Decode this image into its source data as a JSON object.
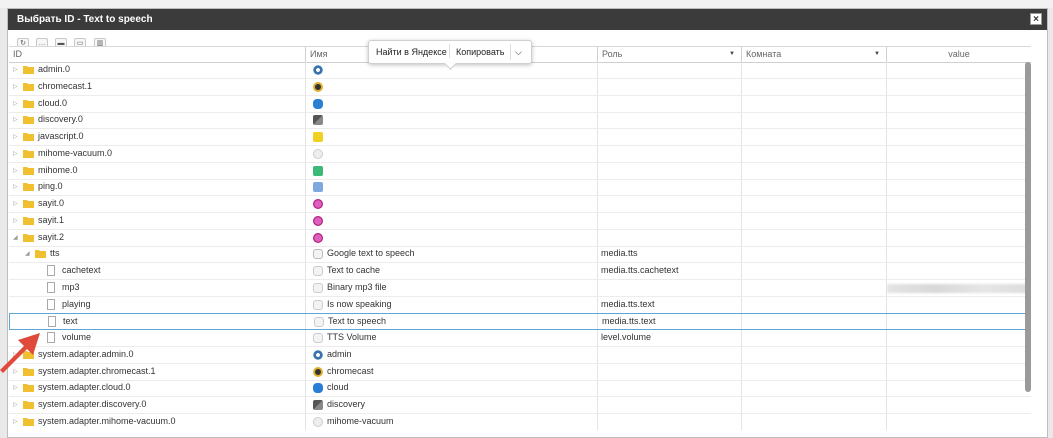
{
  "dialog": {
    "title": "Выбрать ID - Text to speech",
    "close_label": "×"
  },
  "toolbar": {
    "buttons": [
      "refresh",
      "more",
      "collapse",
      "expand",
      "columns"
    ]
  },
  "popup": {
    "search": "Найти в Яндексе",
    "copy": "Копировать",
    "more": "⌵"
  },
  "columns": {
    "id": "ID",
    "name": "Имя",
    "role": "Роль",
    "room": "Комната",
    "value": "value"
  },
  "colors": {
    "titlebar": "#3b3b3b",
    "selection_border": "#5ea5d8",
    "folder": "#f0c030",
    "arrow": "#e04a3a"
  },
  "rows": [
    {
      "id": "admin.0",
      "name": "",
      "role": "",
      "icon": "admin-icon",
      "type": "folder",
      "level": 0,
      "expanded": false
    },
    {
      "id": "chromecast.1",
      "name": "",
      "role": "",
      "icon": "chromecast-icon",
      "type": "folder",
      "level": 0,
      "expanded": false
    },
    {
      "id": "cloud.0",
      "name": "",
      "role": "",
      "icon": "cloud-icon",
      "type": "folder",
      "level": 0,
      "expanded": false
    },
    {
      "id": "discovery.0",
      "name": "",
      "role": "",
      "icon": "discovery-icon",
      "type": "folder",
      "level": 0,
      "expanded": false
    },
    {
      "id": "javascript.0",
      "name": "",
      "role": "",
      "icon": "javascript-icon",
      "type": "folder",
      "level": 0,
      "expanded": false
    },
    {
      "id": "mihome-vacuum.0",
      "name": "",
      "role": "",
      "icon": "mihome-vacuum-icon",
      "type": "folder",
      "level": 0,
      "expanded": false
    },
    {
      "id": "mihome.0",
      "name": "",
      "role": "",
      "icon": "mihome-icon",
      "type": "folder",
      "level": 0,
      "expanded": false
    },
    {
      "id": "ping.0",
      "name": "",
      "role": "",
      "icon": "ping-icon",
      "type": "folder",
      "level": 0,
      "expanded": false
    },
    {
      "id": "sayit.0",
      "name": "",
      "role": "",
      "icon": "sayit-icon",
      "type": "folder",
      "level": 0,
      "expanded": false
    },
    {
      "id": "sayit.1",
      "name": "",
      "role": "",
      "icon": "sayit-icon",
      "type": "folder",
      "level": 0,
      "expanded": false
    },
    {
      "id": "sayit.2",
      "name": "",
      "role": "",
      "icon": "sayit-icon",
      "type": "folder",
      "level": 0,
      "expanded": true
    },
    {
      "id": "tts",
      "name": "Google text to speech",
      "role": "media.tts",
      "icon": "channel-icon",
      "type": "folder",
      "level": 1,
      "expanded": true
    },
    {
      "id": "cachetext",
      "name": "Text to cache",
      "role": "media.tts.cachetext",
      "icon": "state-icon",
      "type": "file",
      "level": 2
    },
    {
      "id": "mp3",
      "name": "Binary mp3 file",
      "role": "",
      "icon": "state-icon",
      "type": "file",
      "level": 2,
      "blurred_value": true
    },
    {
      "id": "playing",
      "name": "Is now speaking",
      "role": "media.tts.text",
      "icon": "state-icon",
      "type": "file",
      "level": 2
    },
    {
      "id": "text",
      "name": "Text to speech",
      "role": "media.tts.text",
      "icon": "state-icon",
      "type": "file",
      "level": 2,
      "selected": true
    },
    {
      "id": "volume",
      "name": "TTS Volume",
      "role": "level.volume",
      "icon": "state-icon",
      "type": "file",
      "level": 2
    },
    {
      "id": "system.adapter.admin.0",
      "name": "admin",
      "role": "",
      "icon": "admin-icon",
      "type": "folder",
      "level": 0,
      "expanded": false
    },
    {
      "id": "system.adapter.chromecast.1",
      "name": "chromecast",
      "role": "",
      "icon": "chromecast-icon",
      "type": "folder",
      "level": 0,
      "expanded": false
    },
    {
      "id": "system.adapter.cloud.0",
      "name": "cloud",
      "role": "",
      "icon": "cloud-icon",
      "type": "folder",
      "level": 0,
      "expanded": false
    },
    {
      "id": "system.adapter.discovery.0",
      "name": "discovery",
      "role": "",
      "icon": "discovery-icon",
      "type": "folder",
      "level": 0,
      "expanded": false
    },
    {
      "id": "system.adapter.mihome-vacuum.0",
      "name": "mihome-vacuum",
      "role": "",
      "icon": "mihome-vacuum-icon",
      "type": "folder",
      "level": 0,
      "expanded": false
    }
  ]
}
